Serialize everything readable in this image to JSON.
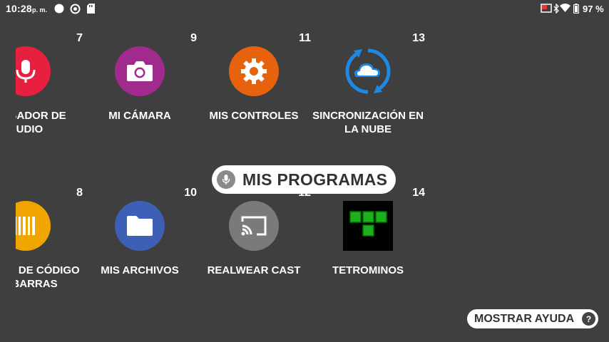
{
  "status_bar": {
    "time": "10:28",
    "ampm": "p. m.",
    "battery_pct": "97 %"
  },
  "apps": [
    {
      "number": "7",
      "label": "GRABADOR DE AUDIO",
      "icon": "microphone-icon",
      "color": "#e8203f"
    },
    {
      "number": "9",
      "label": "MI CÁMARA",
      "icon": "camera-icon",
      "color": "#a12a8f"
    },
    {
      "number": "11",
      "label": "MIS CONTROLES",
      "icon": "gear-icon",
      "color": "#e6620c"
    },
    {
      "number": "13",
      "label": "SINCRONIZACIÓN EN LA NUBE",
      "icon": "cloud-sync-icon",
      "color": "#1e88e5"
    },
    {
      "number": "8",
      "label": "LECTOR DE CÓDIGO DE BARRAS",
      "icon": "barcode-icon",
      "color": "#f0a500"
    },
    {
      "number": "10",
      "label": "MIS ARCHIVOS",
      "icon": "folder-icon",
      "color": "#3d5fb5"
    },
    {
      "number": "12",
      "label": "REALWEAR CAST",
      "icon": "cast-icon",
      "color": "#7a7a7a"
    },
    {
      "number": "14",
      "label": "TETROMINOS",
      "icon": "tetromino-icon",
      "color": "#000000"
    }
  ],
  "section_title": "MIS PROGRAMAS",
  "help_button": {
    "label": "MOSTRAR AYUDA",
    "icon": "question-icon"
  }
}
